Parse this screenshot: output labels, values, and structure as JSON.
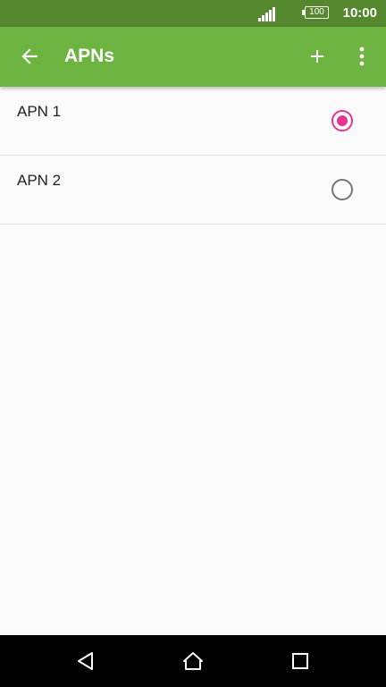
{
  "status_bar": {
    "battery": "100",
    "time": "10:00",
    "icons": [
      "signal-icon",
      "battery-icon"
    ]
  },
  "app_bar": {
    "title": "APNs",
    "icons": [
      "back-arrow-icon",
      "plus-icon",
      "more-vert-icon"
    ]
  },
  "apn_list": [
    {
      "label": "APN 1",
      "selected": true
    },
    {
      "label": "APN 2",
      "selected": false
    }
  ],
  "nav_bar": {
    "icons": [
      "back-triangle-icon",
      "home-icon",
      "recents-icon"
    ]
  },
  "colors": {
    "status_bar": "#55872f",
    "app_bar": "#6db33f",
    "accent": "#e6358f",
    "background": "#fafafa"
  }
}
